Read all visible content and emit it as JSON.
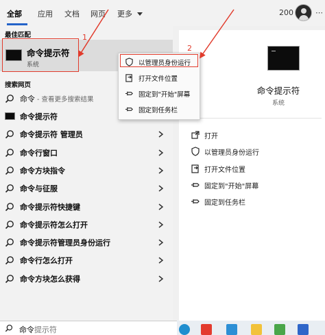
{
  "top": {
    "tabs": [
      "全部",
      "应用",
      "文档",
      "网页",
      "更多"
    ],
    "count": "200",
    "more_glyph": "⋯"
  },
  "left": {
    "best_match_header": "最佳匹配",
    "best_match": {
      "title": "命令提示符",
      "subtitle": "系统",
      "icon": "cmd-terminal-icon"
    },
    "web_header": "搜索网页",
    "web_first": {
      "label": "命令",
      "hint": " - 查看更多搜索结果"
    },
    "results": [
      {
        "label": "命令提示符",
        "icon": "cmd-terminal-icon"
      },
      {
        "label": "命令提示符 管理员",
        "icon": "search-icon"
      },
      {
        "label": "命令行窗口",
        "icon": "search-icon"
      },
      {
        "label": "命令方块指令",
        "icon": "search-icon"
      },
      {
        "label": "命令与征服",
        "icon": "search-icon"
      },
      {
        "label": "命令提示符快捷键",
        "icon": "search-icon"
      },
      {
        "label": "命令提示符怎么打开",
        "icon": "search-icon"
      },
      {
        "label": "命令提示符管理员身份运行",
        "icon": "search-icon"
      },
      {
        "label": "命令行怎么打开",
        "icon": "search-icon"
      },
      {
        "label": "命令方块怎么获得",
        "icon": "search-icon"
      }
    ]
  },
  "context_menu": [
    {
      "label": "以管理员身份运行",
      "icon": "shield-icon"
    },
    {
      "label": "打开文件位置",
      "icon": "folder-icon"
    },
    {
      "label": "固定到\"开始\"屏幕",
      "icon": "pin-icon"
    },
    {
      "label": "固定到任务栏",
      "icon": "pin-icon"
    }
  ],
  "right": {
    "app_title": "命令提示符",
    "app_subtitle": "系统",
    "actions": [
      {
        "label": "打开",
        "icon": "open-icon"
      },
      {
        "label": "以管理员身份运行",
        "icon": "shield-icon"
      },
      {
        "label": "打开文件位置",
        "icon": "folder-icon"
      },
      {
        "label": "固定到\"开始\"屏幕",
        "icon": "pin-icon"
      },
      {
        "label": "固定到任务栏",
        "icon": "pin-icon"
      }
    ]
  },
  "annotations": {
    "one": "1",
    "two": "2"
  },
  "search": {
    "typed": "命令",
    "suggestion": "提示符"
  },
  "colors": {
    "accent": "#2463c9",
    "annotation_red": "#e13b2c",
    "selected_bg": "#dcdcdc"
  }
}
